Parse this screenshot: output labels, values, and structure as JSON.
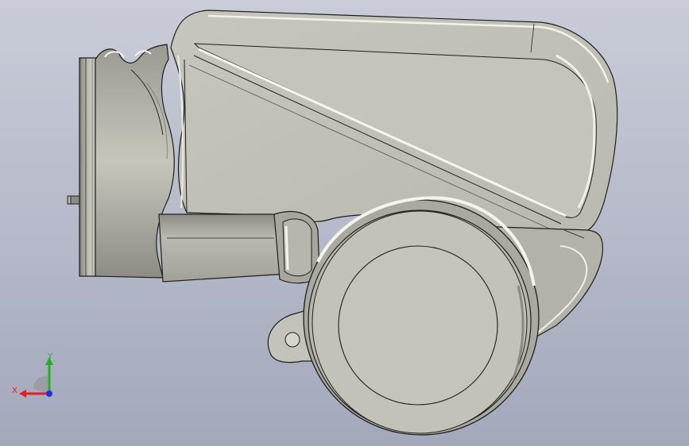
{
  "viewport": {
    "background_top": "#c7cad6",
    "background_bottom": "#a6abbd"
  },
  "model": {
    "name": "robot-arm-housing",
    "body_color": "#c2c2b8",
    "shadow_color": "#8a8a82",
    "edge_color": "#1e1e1e",
    "highlight_color": "#f2f2ea"
  },
  "triad": {
    "x_label": "X",
    "y_label": "Y",
    "x_color": "#e02020",
    "y_color": "#20b020",
    "z_color": "#2030e0"
  }
}
